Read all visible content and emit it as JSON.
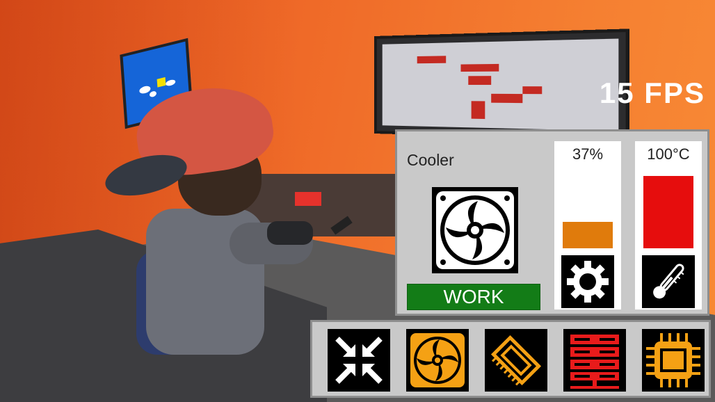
{
  "hud": {
    "fps": "15 FPS"
  },
  "cooler_panel": {
    "title": "Cooler",
    "status_button": "WORK",
    "usage": {
      "label": "37%",
      "fill_fraction": 0.37,
      "color": "#e07b0c"
    },
    "temperature": {
      "label": "100°C",
      "fill_fraction": 1.0,
      "color": "#e60d0d"
    },
    "icons": {
      "fan": "fan-icon",
      "settings": "gear-icon",
      "temp": "thermometer-icon"
    }
  },
  "toolbar": {
    "items": [
      {
        "icon": "collapse-arrows-icon",
        "color": "#ffffff"
      },
      {
        "icon": "cooler-fan-icon",
        "color": "#f5a114"
      },
      {
        "icon": "ram-chip-icon",
        "color": "#f5a114"
      },
      {
        "icon": "server-rack-icon",
        "color": "#e81b1b"
      },
      {
        "icon": "cpu-icon",
        "color": "#f5a114"
      }
    ]
  }
}
